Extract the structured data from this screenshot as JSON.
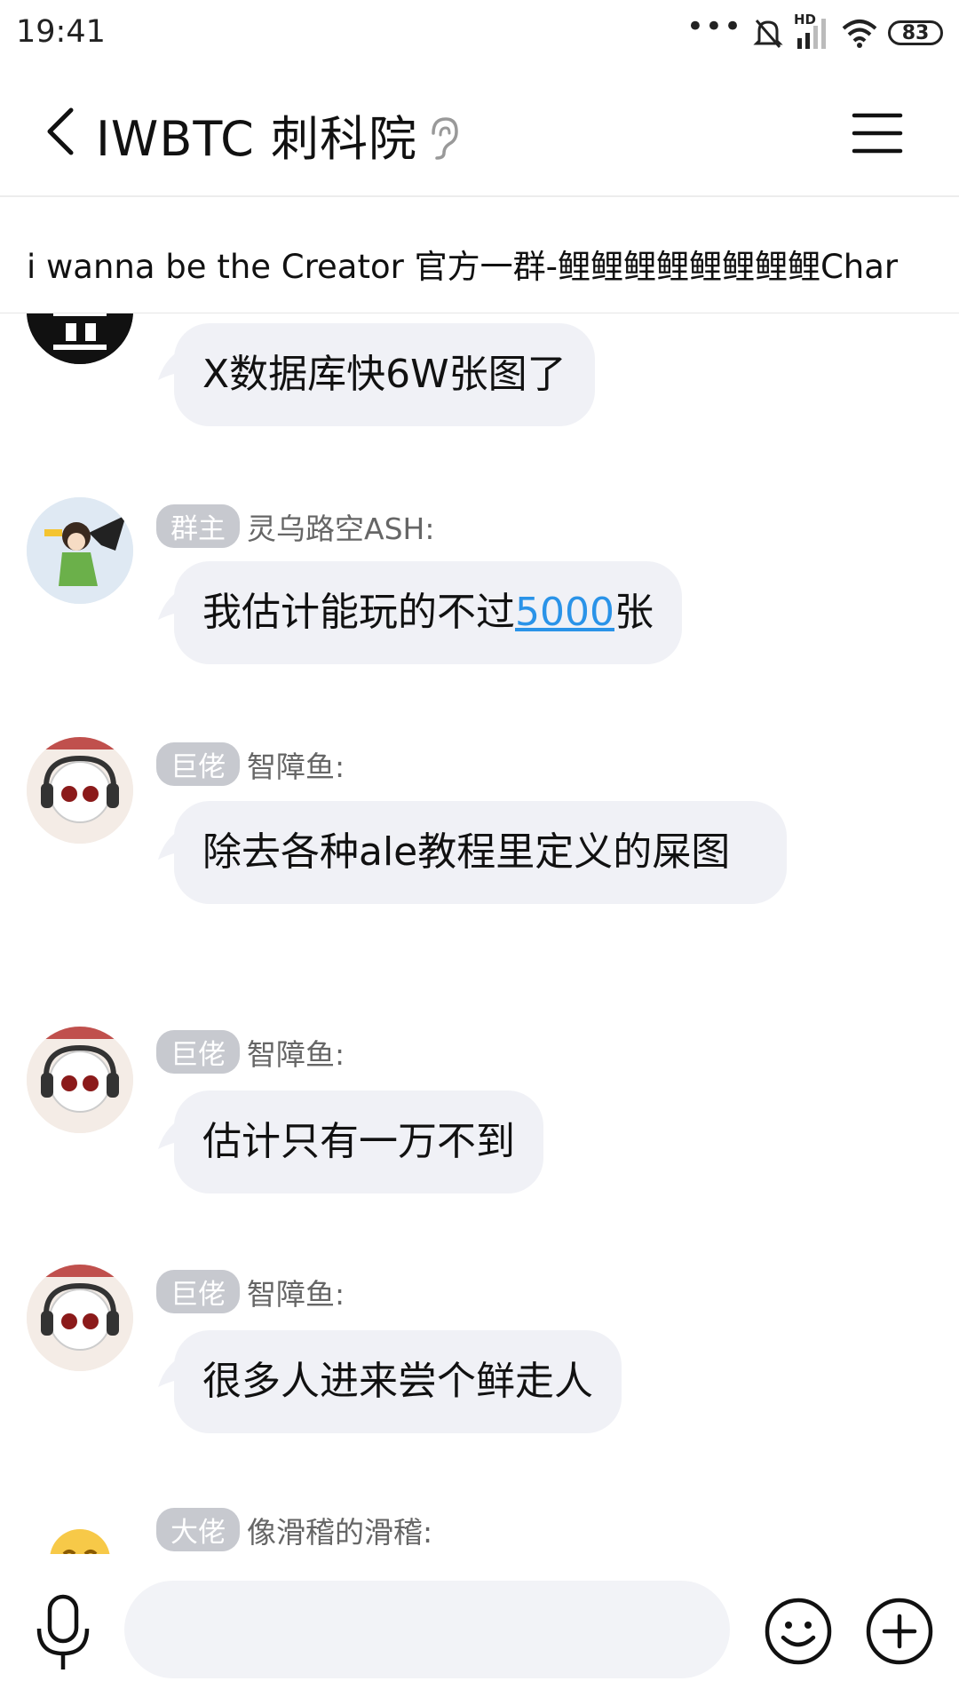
{
  "status_bar": {
    "time": "19:41",
    "network_label": "HD",
    "battery": "83"
  },
  "header": {
    "title": "IWBTC 刺科院"
  },
  "notice": {
    "text": "i wanna be the Creator 官方一群-鲤鲤鲤鲤鲤鲤鲤鲤Char"
  },
  "messages": [
    {
      "badge": "",
      "sender": "",
      "text": "X数据库快6W张图了"
    },
    {
      "badge": "群主",
      "sender": "灵乌路空ASH:",
      "text_before": "我估计能玩的不过",
      "link": "5000",
      "text_after": "张"
    },
    {
      "badge": "巨佬",
      "sender": "智障鱼:",
      "text": "除去各种ale教程里定义的屎图"
    },
    {
      "badge": "巨佬",
      "sender": "智障鱼:",
      "text": "估计只有一万不到"
    },
    {
      "badge": "巨佬",
      "sender": "智障鱼:",
      "text": "很多人进来尝个鲜走人"
    },
    {
      "badge": "大佬",
      "sender": "像滑稽的滑稽:",
      "text": ""
    }
  ],
  "input": {
    "placeholder": ""
  },
  "icons": {
    "back": "chevron-left-icon",
    "ear": "ear-icon",
    "menu": "menu-icon",
    "mic": "microphone-icon",
    "emoji": "smiley-icon",
    "plus": "plus-circle-icon"
  },
  "colors": {
    "bubble": "#f0f1f6",
    "badge": "#c7c9cf",
    "link": "#2a93e8"
  }
}
